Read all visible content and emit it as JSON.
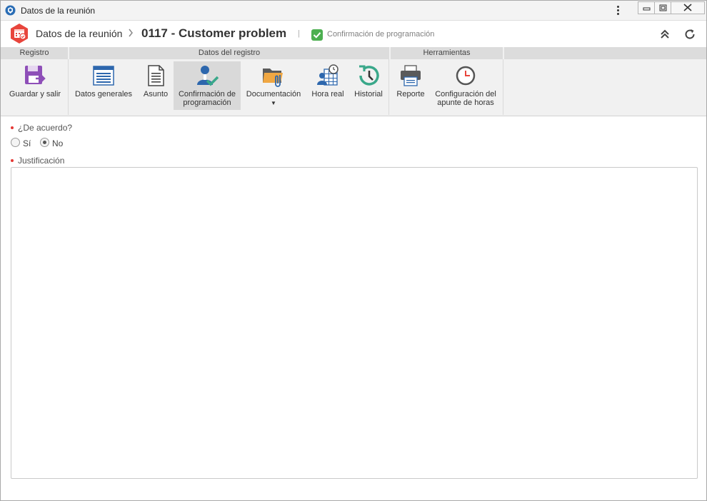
{
  "window": {
    "title": "Datos de la reunión"
  },
  "header": {
    "breadcrumb_parent": "Datos de la reunión",
    "record_title": "0117 - Customer problem",
    "separator": "|",
    "status_label": "Confirmación de programación",
    "icons": [
      "collapse-up-icon",
      "refresh-icon"
    ]
  },
  "ribbon": {
    "groups": [
      {
        "label": "Registro"
      },
      {
        "label": "Datos del registro"
      },
      {
        "label": "Herramientas"
      }
    ],
    "buttons": [
      {
        "label": "Guardar y salir",
        "icon": "save-exit-icon"
      },
      {
        "label": "Datos generales",
        "icon": "form-window-icon"
      },
      {
        "label": "Asunto",
        "icon": "document-icon"
      },
      {
        "label_line1": "Confirmación de",
        "label_line2": "programación",
        "icon": "user-check-icon",
        "active": true
      },
      {
        "label": "Documentación",
        "icon": "folder-attachment-icon",
        "dropdown": true
      },
      {
        "label": "Hora real",
        "icon": "user-schedule-icon"
      },
      {
        "label": "Historial",
        "icon": "history-icon"
      },
      {
        "label": "Reporte",
        "icon": "printer-icon"
      },
      {
        "label_line1": "Configuración del",
        "label_line2": "apunte de horas",
        "icon": "clock-icon"
      }
    ]
  },
  "form": {
    "agree_label": "¿De acuerdo?",
    "options": [
      {
        "label": "Sí",
        "checked": false
      },
      {
        "label": "No",
        "checked": true
      }
    ],
    "justification_label": "Justificación",
    "justification_value": ""
  },
  "colors": {
    "accent_red": "#e8453c",
    "status_green": "#4caf50",
    "required_dot": "#e53935"
  }
}
